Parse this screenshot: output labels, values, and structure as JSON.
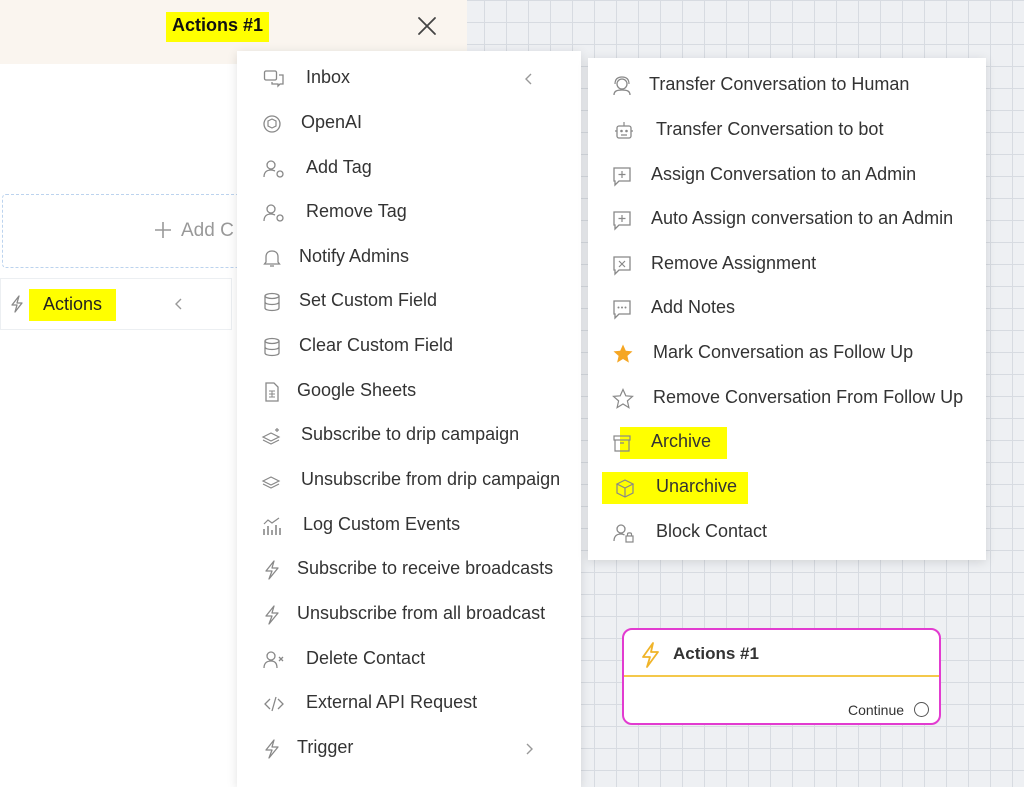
{
  "panel": {
    "title": "Actions #1",
    "add_label": "Add C",
    "actions_label": "Actions"
  },
  "menu_primary": {
    "items": [
      {
        "label": "Inbox",
        "icon": "chat-bubbles-icon"
      },
      {
        "label": "OpenAI",
        "icon": "openai-icon"
      },
      {
        "label": "Add Tag",
        "icon": "user-tag-add-icon"
      },
      {
        "label": "Remove Tag",
        "icon": "user-tag-remove-icon"
      },
      {
        "label": "Notify Admins",
        "icon": "bell-icon"
      },
      {
        "label": "Set Custom Field",
        "icon": "database-icon"
      },
      {
        "label": "Clear Custom Field",
        "icon": "database-icon"
      },
      {
        "label": "Google Sheets",
        "icon": "spreadsheet-icon"
      },
      {
        "label": "Subscribe to drip campaign",
        "icon": "layers-add-icon"
      },
      {
        "label": "Unsubscribe from drip campaign",
        "icon": "layers-remove-icon"
      },
      {
        "label": "Log Custom Events",
        "icon": "analytics-icon"
      },
      {
        "label": "Subscribe to receive broadcasts",
        "icon": "bolt-icon"
      },
      {
        "label": "Unsubscribe from all broadcast",
        "icon": "bolt-icon"
      },
      {
        "label": "Delete Contact",
        "icon": "user-remove-icon"
      },
      {
        "label": "External API Request",
        "icon": "code-icon"
      },
      {
        "label": "Trigger",
        "icon": "bolt-icon"
      }
    ]
  },
  "menu_inbox": {
    "items": [
      {
        "label": "Transfer Conversation to Human",
        "icon": "headset-icon"
      },
      {
        "label": "Transfer Conversation to bot",
        "icon": "robot-icon"
      },
      {
        "label": "Assign Conversation to an Admin",
        "icon": "message-plus-icon"
      },
      {
        "label": "Auto Assign conversation to an Admin",
        "icon": "message-plus-icon"
      },
      {
        "label": "Remove Assignment",
        "icon": "message-x-icon"
      },
      {
        "label": "Add Notes",
        "icon": "message-dots-icon"
      },
      {
        "label": "Mark Conversation as Follow Up",
        "icon": "star-filled-icon"
      },
      {
        "label": "Remove Conversation From Follow Up",
        "icon": "star-outline-icon"
      },
      {
        "label": "Archive",
        "icon": "archive-icon"
      },
      {
        "label": "Unarchive",
        "icon": "unarchive-icon"
      },
      {
        "label": "Block Contact",
        "icon": "user-lock-icon"
      }
    ]
  },
  "node": {
    "title": "Actions #1",
    "continue_label": "Continue"
  },
  "colors": {
    "highlight": "#ffff00",
    "node_border": "#e23bd0",
    "node_divider": "#f4c84b",
    "star": "#f5a623",
    "header_bg": "#faf5ef"
  }
}
